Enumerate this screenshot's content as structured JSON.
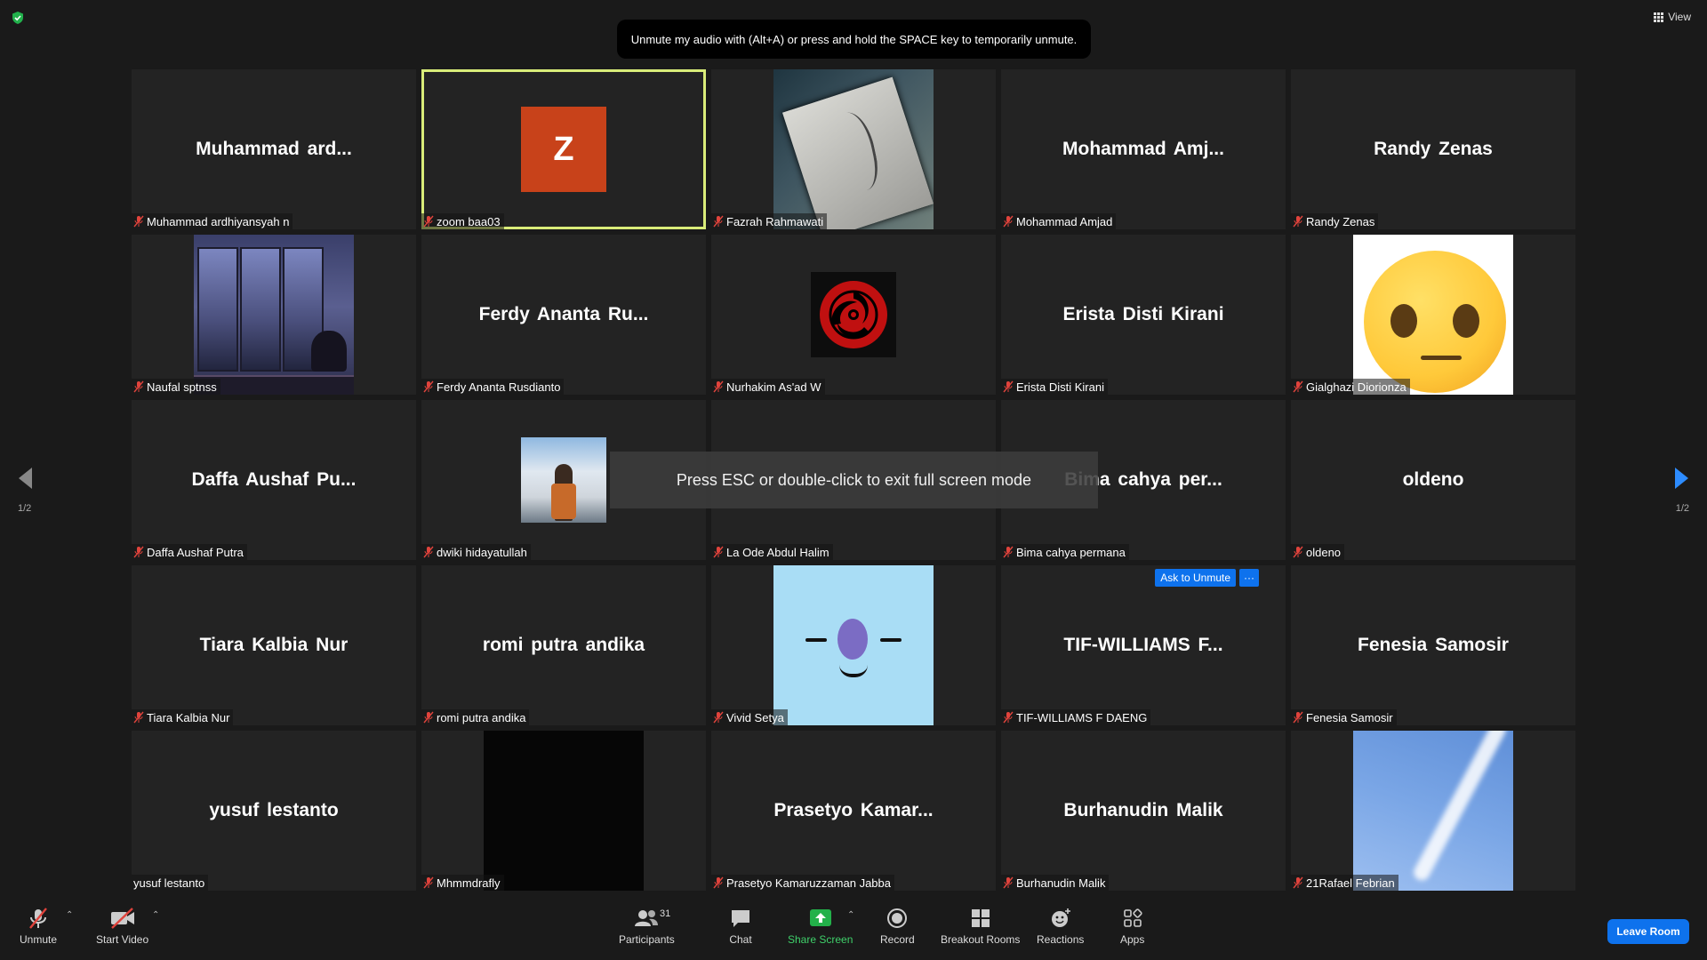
{
  "header": {
    "view_label": "View",
    "unmute_hint": "Unmute my audio with (Alt+A) or press and hold the SPACE key to temporarily unmute."
  },
  "overlay": {
    "fullscreen_text": "Press ESC or double-click to exit full screen mode"
  },
  "pagination": {
    "left": "1/2",
    "right": "1/2"
  },
  "tiles": [
    {
      "big": "Muhammad  ard...",
      "label": "Muhammad ardhiyansyah n",
      "muted": true
    },
    {
      "avatar": "Z",
      "label": "zoom baa03",
      "muted": true,
      "active": true
    },
    {
      "label": "Fazrah Rahmawati",
      "muted": true
    },
    {
      "big": "Mohammad  Amj...",
      "label": "Mohammad Amjad",
      "muted": true
    },
    {
      "big": "Randy Zenas",
      "label": "Randy Zenas",
      "muted": true
    },
    {
      "label": "Naufal sptnss",
      "muted": true
    },
    {
      "big": "Ferdy  Ananta  Ru...",
      "label": "Ferdy Ananta Rusdianto",
      "muted": true
    },
    {
      "label": "Nurhakim As'ad W",
      "muted": true
    },
    {
      "big": "Erista Disti Kirani",
      "label": "Erista Disti Kirani",
      "muted": true
    },
    {
      "label": "Gialghazi Diorionza",
      "muted": true
    },
    {
      "big": "Daffa  Aushaf  Pu...",
      "label": "Daffa Aushaf Putra",
      "muted": true
    },
    {
      "label": "dwiki hidayatullah",
      "muted": true
    },
    {
      "big": "",
      "label": "La Ode Abdul Halim",
      "muted": true
    },
    {
      "big": "Bima cahya per...",
      "label": "Bima cahya permana",
      "muted": true
    },
    {
      "big": "oldeno",
      "label": "oldeno",
      "muted": true
    },
    {
      "big": "Tiara Kalbia Nur",
      "label": "Tiara Kalbia Nur",
      "muted": true
    },
    {
      "big": "romi putra andika",
      "label": "romi putra andika",
      "muted": true
    },
    {
      "label": "Vivid Setya",
      "muted": true
    },
    {
      "big": "TIF-WILLIAMS  F...",
      "label": "TIF-WILLIAMS F DAENG",
      "muted": true,
      "ask_unmute": "Ask to Unmute",
      "more": "···"
    },
    {
      "big": "Fenesia Samosir",
      "label": "Fenesia Samosir",
      "muted": true
    },
    {
      "big": "yusuf lestanto",
      "label": "yusuf lestanto",
      "muted": false
    },
    {
      "label": "Mhmmdrafly",
      "muted": true
    },
    {
      "big": "Prasetyo  Kamar...",
      "label": "Prasetyo Kamaruzzaman Jabba",
      "muted": true
    },
    {
      "big": "Burhanudin Malik",
      "label": "Burhanudin Malik",
      "muted": true
    },
    {
      "label": "21Rafael Febrian",
      "muted": true
    }
  ],
  "toolbar": {
    "unmute": "Unmute",
    "start_video": "Start Video",
    "participants": "Participants",
    "participants_count": "31",
    "chat": "Chat",
    "share_screen": "Share Screen",
    "record": "Record",
    "breakout_rooms": "Breakout Rooms",
    "reactions": "Reactions",
    "apps": "Apps",
    "leave": "Leave Room"
  },
  "colors": {
    "active_border": "#d9ec79",
    "accent_blue": "#0e72ed",
    "share_green": "#3fd06a",
    "mute_red": "#e0433c"
  }
}
